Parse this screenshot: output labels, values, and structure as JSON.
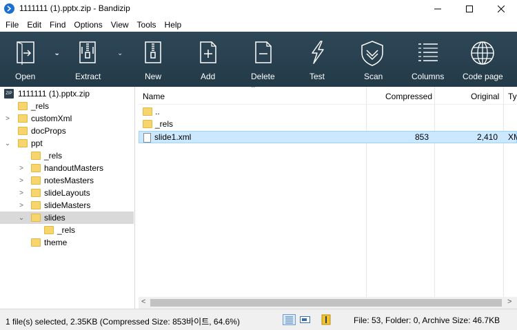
{
  "window": {
    "title": "1111111 (1).pptx.zip - Bandizip",
    "minimize": "—",
    "maximize": "☐",
    "close": "✕"
  },
  "menu": [
    "File",
    "Edit",
    "Find",
    "Options",
    "View",
    "Tools",
    "Help"
  ],
  "toolbar": {
    "buttons": [
      {
        "label": "Open",
        "icon": "open-icon"
      },
      {
        "label": "Extract",
        "icon": "extract-icon"
      },
      {
        "label": "New",
        "icon": "new-archive-icon"
      },
      {
        "label": "Add",
        "icon": "add-icon"
      },
      {
        "label": "Delete",
        "icon": "delete-icon"
      },
      {
        "label": "Test",
        "icon": "test-icon"
      },
      {
        "label": "Scan",
        "icon": "scan-icon"
      },
      {
        "label": "Columns",
        "icon": "columns-icon"
      },
      {
        "label": "Code page",
        "icon": "code-page-icon"
      }
    ]
  },
  "tree": {
    "root": "1111111 (1).pptx.zip",
    "items": [
      {
        "label": "_rels"
      },
      {
        "label": "customXml"
      },
      {
        "label": "docProps"
      },
      {
        "label": "ppt"
      },
      {
        "label": "_rels"
      },
      {
        "label": "handoutMasters"
      },
      {
        "label": "notesMasters"
      },
      {
        "label": "slideLayouts"
      },
      {
        "label": "slideMasters"
      },
      {
        "label": "slides"
      },
      {
        "label": "_rels"
      },
      {
        "label": "theme"
      }
    ]
  },
  "list": {
    "columns": {
      "name": "Name",
      "compressed": "Compressed",
      "original": "Original",
      "type": "Ty"
    },
    "rows": [
      {
        "name": "..",
        "compressed": "",
        "original": "",
        "type": ""
      },
      {
        "name": "_rels",
        "compressed": "",
        "original": "",
        "type": ""
      },
      {
        "name": "slide1.xml",
        "compressed": "853",
        "original": "2,410",
        "type": "XM"
      }
    ]
  },
  "status": {
    "selection": "1 file(s) selected, 2.35KB (Compressed Size: 853바이트, 64.6%)",
    "summary": "File: 53, Folder: 0, Archive Size: 46.7KB"
  },
  "colors": {
    "toolbar_bg": "#2b4353",
    "selection": "#cce8ff",
    "folder": "#f7d56e",
    "app_icon": "#1b6fd1"
  }
}
